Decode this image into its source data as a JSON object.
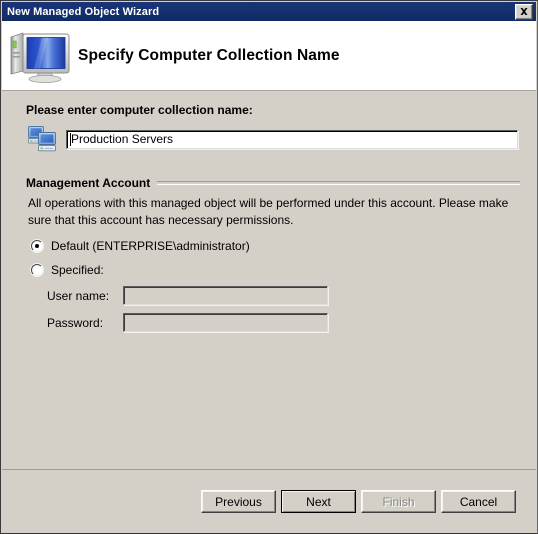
{
  "window": {
    "title": "New Managed Object Wizard",
    "close_label": "Close",
    "close_icon": "close-icon"
  },
  "header": {
    "title": "Specify Computer Collection Name",
    "icon": "computer-monitor-icon"
  },
  "main": {
    "collection_name_label": "Please enter computer collection name:",
    "collection_icon": "computers-collection-icon",
    "collection_name_value": "Production Servers",
    "collection_name_placeholder": "",
    "group": {
      "title": "Management Account",
      "description": "All operations with this managed object will be performed under this account. Please make sure that this account has necessary permissions.",
      "options": [
        {
          "label": "Default (ENTERPRISE\\administrator)",
          "selected": true
        },
        {
          "label": "Specified:",
          "selected": false
        }
      ],
      "fields": [
        {
          "label": "User name:",
          "value": "",
          "enabled": false
        },
        {
          "label": "Password:",
          "value": "",
          "enabled": false
        }
      ]
    }
  },
  "footer": {
    "buttons": [
      {
        "label": "Previous",
        "state": "enabled"
      },
      {
        "label": "Next",
        "state": "default"
      },
      {
        "label": "Finish",
        "state": "disabled"
      },
      {
        "label": "Cancel",
        "state": "enabled"
      }
    ]
  },
  "colors": {
    "titlebar": "#15306f",
    "dialog_face": "#d4d0c8",
    "header_band": "#ffffff",
    "text": "#000000",
    "disabled_text": "#868682"
  }
}
